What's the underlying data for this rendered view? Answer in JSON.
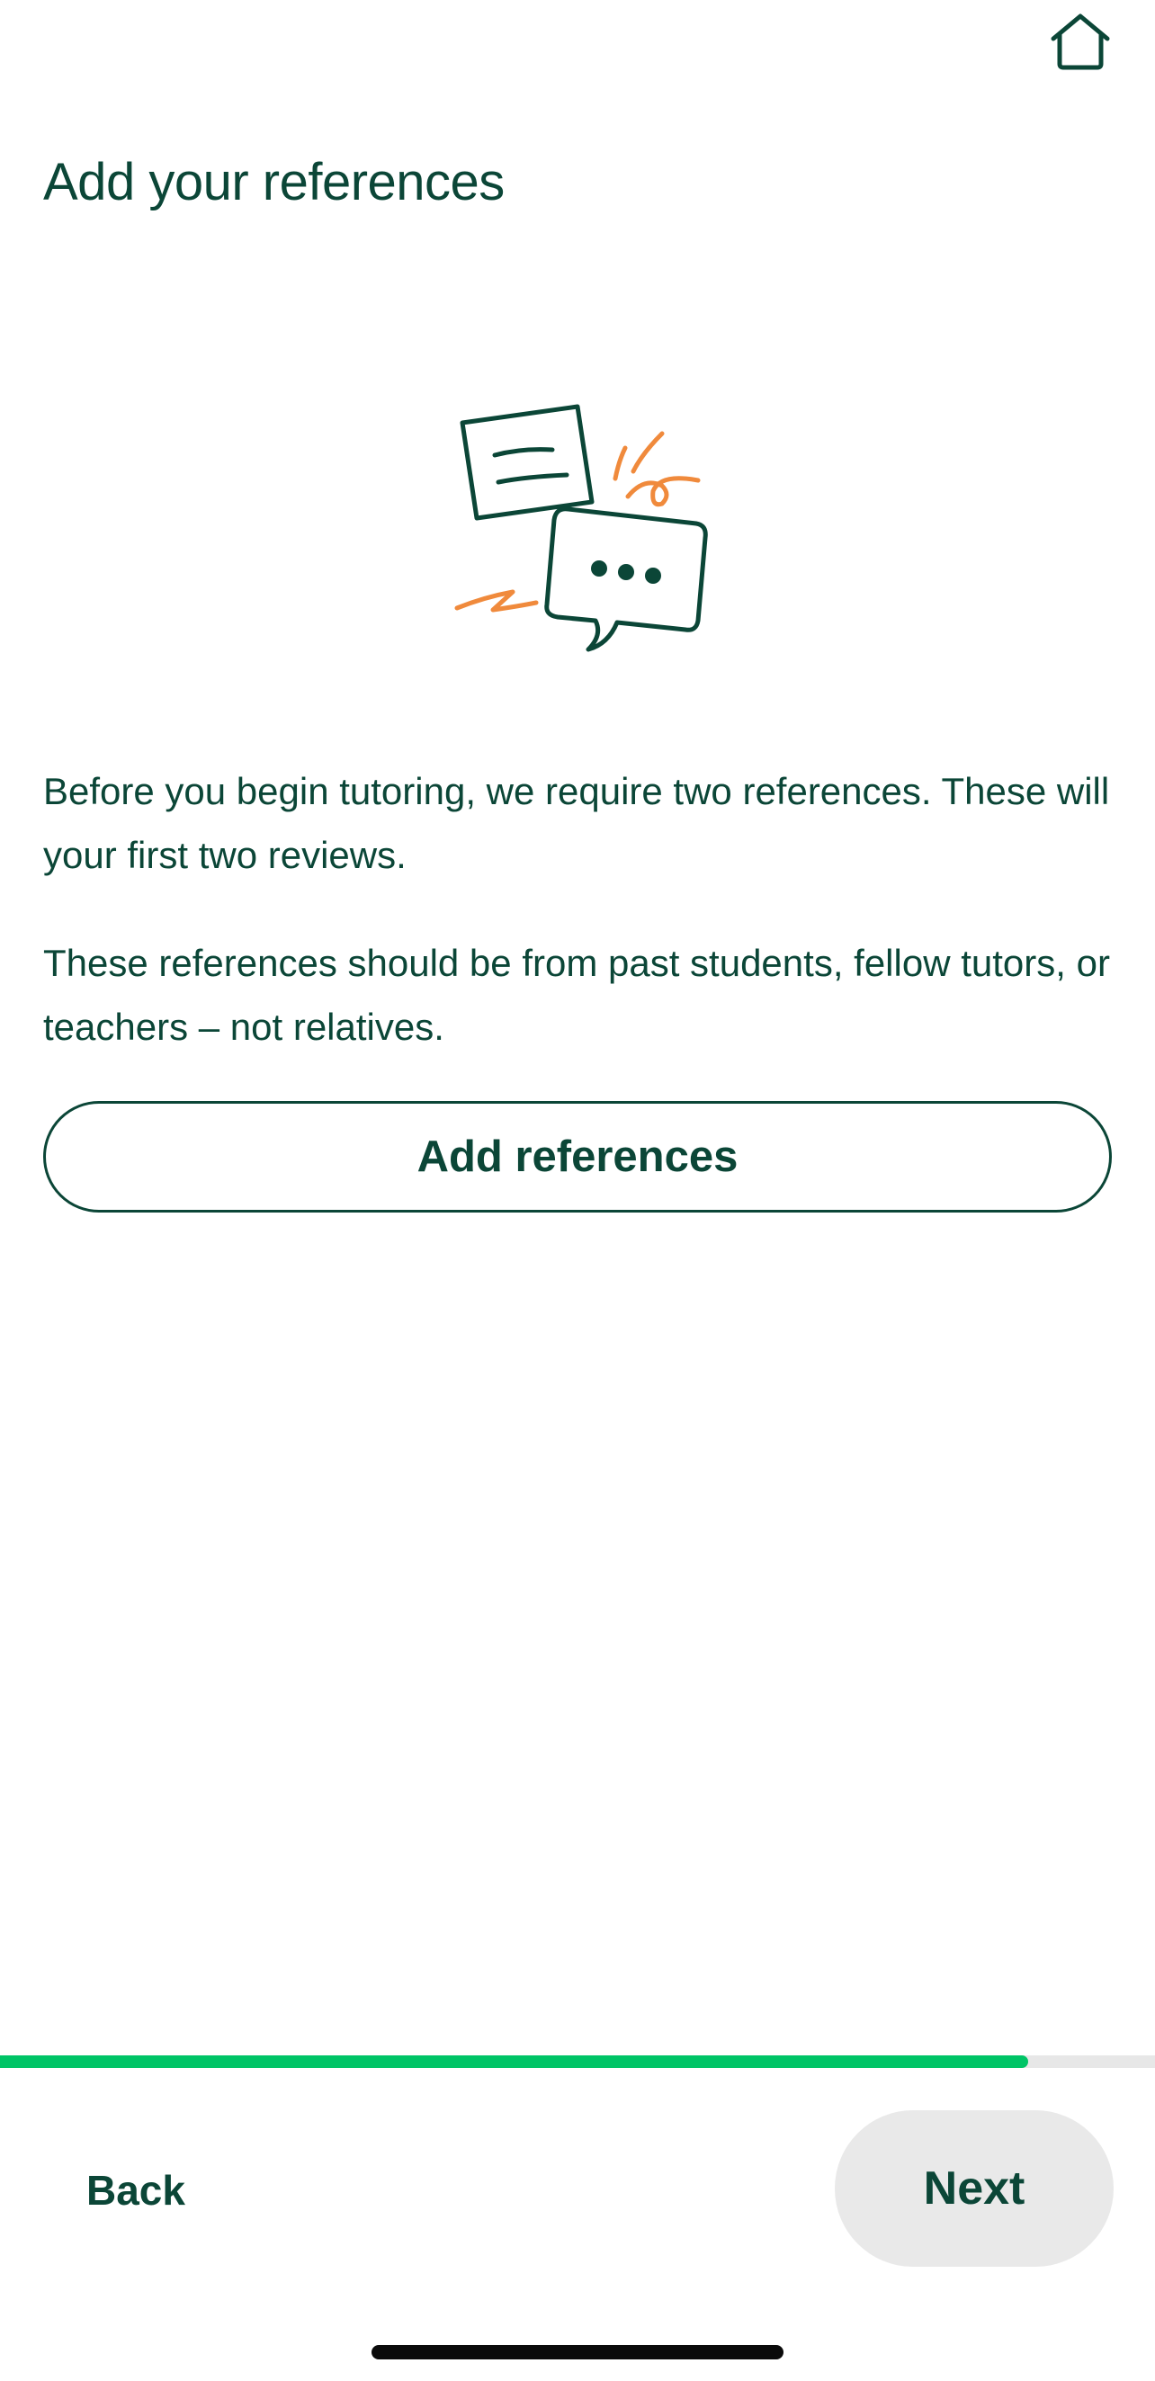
{
  "header": {
    "title": "Add your references",
    "home_icon": "home-icon"
  },
  "content": {
    "illustration": "document-and-chat-bubble-illustration",
    "paragraph_1": "Before you begin tutoring, we require two references. These will your first two reviews.",
    "paragraph_2": "These references should be from past students, fellow tutors, or teachers – not relatives.",
    "add_references_label": "Add references"
  },
  "progress": {
    "fraction": 0.89
  },
  "footer": {
    "back_label": "Back",
    "next_label": "Next"
  },
  "colors": {
    "primary_text": "#0b4637",
    "accent_orange": "#f08a3c",
    "progress_green": "#00c466",
    "progress_track": "#e7e7e7",
    "next_button_bg": "#e9e9e9"
  }
}
